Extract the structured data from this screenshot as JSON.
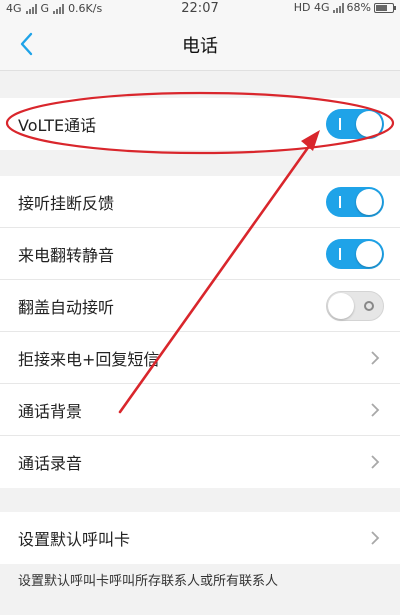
{
  "status_bar": {
    "left_net1": "4G",
    "left_net2": "G",
    "speed": "0.6K/s",
    "time": "22:07",
    "right_net": "HD 4G",
    "battery": "68%",
    "battery_level": 0.68
  },
  "header": {
    "title": "电话",
    "back_icon": "chevron-left-icon"
  },
  "volte": {
    "label": "VoLTE通话",
    "enabled": true
  },
  "call_settings": [
    {
      "label": "接听挂断反馈",
      "type": "toggle",
      "enabled": true
    },
    {
      "label": "来电翻转静音",
      "type": "toggle",
      "enabled": true
    },
    {
      "label": "翻盖自动接听",
      "type": "toggle",
      "enabled": false
    },
    {
      "label": "拒接来电+回复短信",
      "type": "link"
    },
    {
      "label": "通话背景",
      "type": "link"
    },
    {
      "label": "通话录音",
      "type": "link"
    }
  ],
  "default_card": {
    "label": "设置默认呼叫卡",
    "type": "link"
  },
  "footnote": "设置默认呼叫卡呼叫所存联系人或所有联系人",
  "colors": {
    "accent": "#1fa3e8",
    "annotation": "#d9262c"
  }
}
